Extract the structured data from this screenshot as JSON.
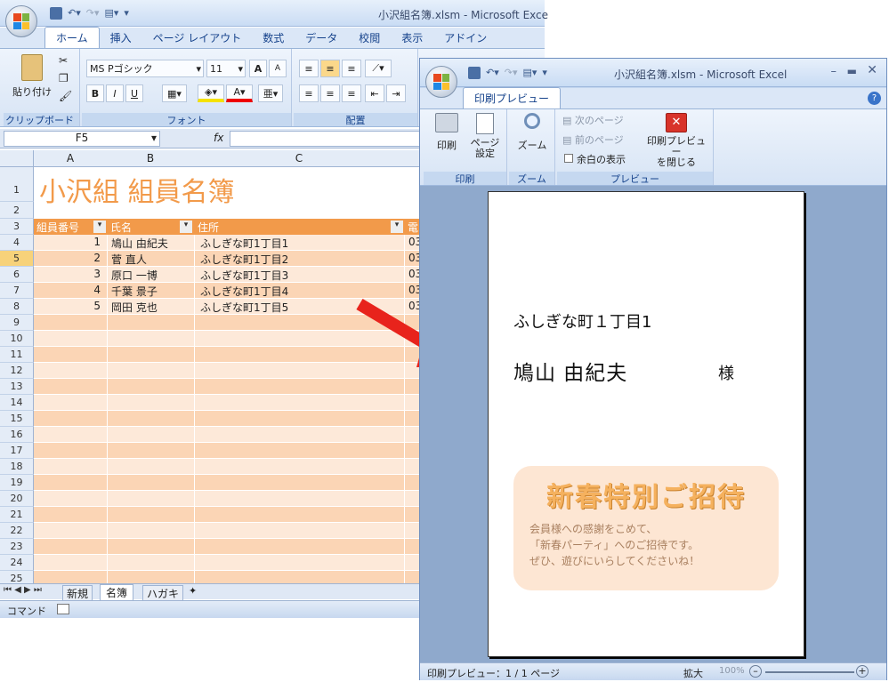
{
  "back": {
    "window_title": "小沢組名簿.xlsm - Microsoft Exce",
    "tabs": [
      "ホーム",
      "挿入",
      "ページ レイアウト",
      "数式",
      "データ",
      "校閲",
      "表示",
      "アドイン"
    ],
    "clipboard_label": "クリップボード",
    "paste_label": "貼り付け",
    "font_group_label": "フォント",
    "align_group_label": "配置",
    "font_name": "MS Pゴシック",
    "font_size": "11",
    "bold": "B",
    "italic": "I",
    "underline": "U",
    "grow_font": "A",
    "shrink_font": "A",
    "cell_ref": "F5",
    "fx": "fx",
    "col_headers": [
      "A",
      "B",
      "C"
    ],
    "sheet_title": "小沢組 組員名簿",
    "table_headers": [
      "組員番号",
      "氏名",
      "住所",
      "電"
    ],
    "rows": [
      {
        "no": "1",
        "name": "鳩山 由紀夫",
        "addr": "ふしぎな町1丁目1",
        "tel": "03"
      },
      {
        "no": "2",
        "name": "菅 直人",
        "addr": "ふしぎな町1丁目2",
        "tel": "03"
      },
      {
        "no": "3",
        "name": "原口 一博",
        "addr": "ふしぎな町1丁目3",
        "tel": "03"
      },
      {
        "no": "4",
        "name": "千葉 景子",
        "addr": "ふしぎな町1丁目4",
        "tel": "03"
      },
      {
        "no": "5",
        "name": "岡田 克也",
        "addr": "ふしぎな町1丁目5",
        "tel": "03"
      }
    ],
    "row_numbers": [
      "1",
      "2",
      "3",
      "4",
      "5",
      "6",
      "7",
      "8",
      "9",
      "10",
      "11",
      "12",
      "13",
      "14",
      "15",
      "16",
      "17",
      "18",
      "19",
      "20",
      "21",
      "22",
      "23",
      "24",
      "25"
    ],
    "sheet_tabs": [
      "新規",
      "名簿",
      "ハガキ"
    ],
    "status_mode": "コマンド"
  },
  "front": {
    "window_title": "小沢組名簿.xlsm - Microsoft Excel",
    "tab": "印刷プレビュー",
    "print_label": "印刷",
    "page_setup_label": "ページ\n設定",
    "zoom_label": "ズーム",
    "next_page": "次のページ",
    "prev_page": "前のページ",
    "show_margins": "余白の表示",
    "close_label": "印刷プレビュー\nを閉じる",
    "grp_print": "印刷",
    "grp_zoom": "ズーム",
    "grp_preview": "プレビュー",
    "page": {
      "address": "ふしぎな町１丁目1",
      "name": "鳩山 由紀夫",
      "honorific": "様",
      "card_title": "新春特別ご招待",
      "card_lines": [
        "会員様への感謝をこめて、",
        "「新春パーティ」へのご招待です。",
        "ぜひ、遊びにいらしてくださいね！"
      ]
    },
    "status": "印刷プレビュー：1 / 1 ページ",
    "zoom_in_label": "拡大",
    "zoom_percent": "100%"
  },
  "colors": {
    "accent": "#f29a4a",
    "row_light": "#fde9d9",
    "row_dark": "#fbd5b5",
    "red_arrow": "#e8231c"
  }
}
